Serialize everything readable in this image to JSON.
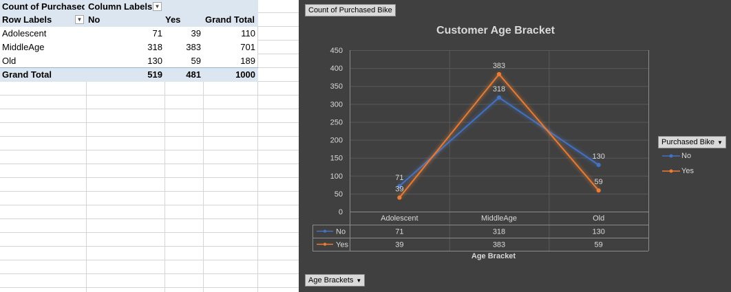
{
  "pivot": {
    "header1": {
      "c1": "Count of Purchased",
      "c2": "Column Labels"
    },
    "header2": {
      "c1": "Row Labels",
      "c2": "No",
      "c3": "Yes",
      "c4": "Grand Total"
    },
    "rows": [
      {
        "label": "Adolescent",
        "no": "71",
        "yes": "39",
        "total": "110"
      },
      {
        "label": "MiddleAge",
        "no": "318",
        "yes": "383",
        "total": "701"
      },
      {
        "label": "Old",
        "no": "130",
        "yes": "59",
        "total": "189"
      }
    ],
    "grand_total": {
      "label": "Grand Total",
      "no": "519",
      "yes": "481",
      "total": "1000"
    }
  },
  "chart": {
    "value_field_button": "Count of Purchased Bike",
    "legend_field_button": "Purchased Bike",
    "axis_field_button": "Age Brackets",
    "colors": {
      "no": "#4472c4",
      "yes": "#ed7d31",
      "background": "#404040",
      "text": "#d9d9d9"
    }
  },
  "chart_data": {
    "type": "line",
    "title": "Customer Age Bracket",
    "xlabel": "Age Bracket",
    "ylabel": "",
    "categories": [
      "Adolescent",
      "MiddleAge",
      "Old"
    ],
    "series": [
      {
        "name": "No",
        "values": [
          71,
          318,
          130
        ],
        "color": "#4472c4"
      },
      {
        "name": "Yes",
        "values": [
          39,
          383,
          59
        ],
        "color": "#ed7d31"
      }
    ],
    "ylim": [
      0,
      450
    ],
    "yticks": [
      "0",
      "50",
      "100",
      "150",
      "200",
      "250",
      "300",
      "350",
      "400",
      "450"
    ],
    "grid": true,
    "legend": "right",
    "data_table": true
  }
}
